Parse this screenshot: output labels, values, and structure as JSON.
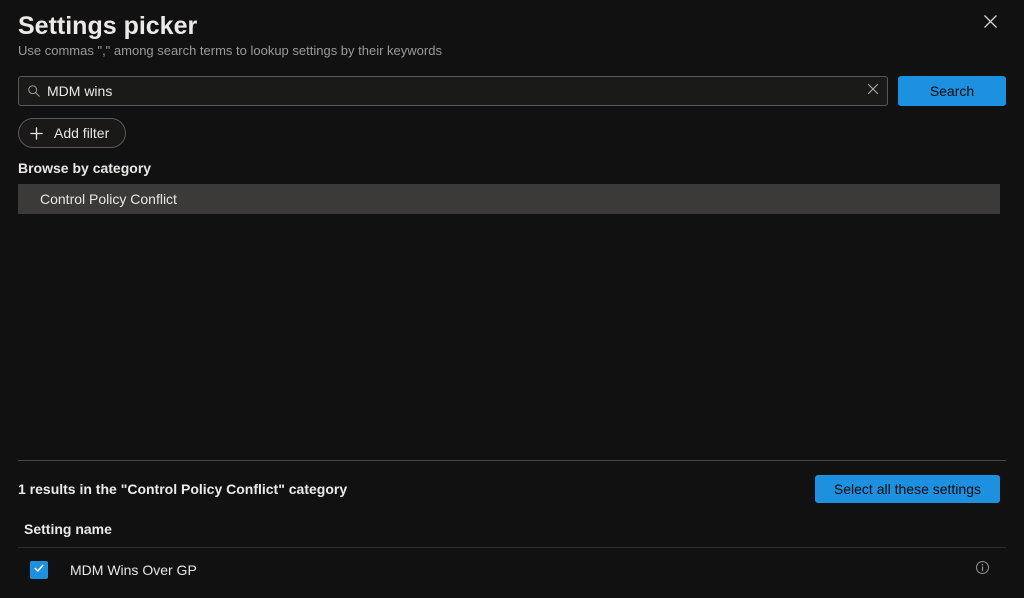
{
  "header": {
    "title": "Settings picker",
    "subtitle": "Use commas \",\" among search terms to lookup settings by their keywords"
  },
  "search": {
    "value": "MDM wins",
    "button_label": "Search"
  },
  "filter": {
    "add_label": "Add filter"
  },
  "browse": {
    "heading": "Browse by category",
    "categories": [
      {
        "label": "Control Policy Conflict"
      }
    ]
  },
  "results": {
    "summary": "1 results in the \"Control Policy Conflict\" category",
    "select_all_label": "Select all these settings",
    "column_header": "Setting name",
    "items": [
      {
        "label": "MDM Wins Over GP",
        "checked": true
      }
    ]
  }
}
